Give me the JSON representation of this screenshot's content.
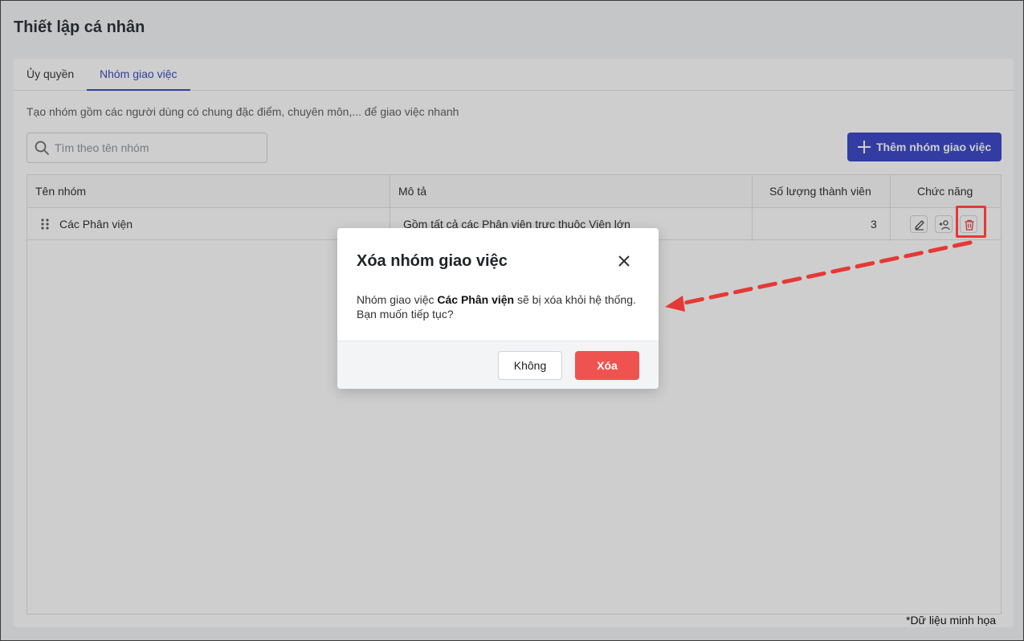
{
  "page": {
    "title": "Thiết lập cá nhân"
  },
  "tabs": [
    {
      "label": "Ủy quyền"
    },
    {
      "label": "Nhóm giao việc",
      "active": true
    }
  ],
  "description": "Tạo nhóm gồm các người dùng có chung đặc điểm, chuyên môn,... để giao việc nhanh",
  "search": {
    "placeholder": "Tìm theo tên nhóm",
    "value": ""
  },
  "add_button": {
    "label": "Thêm nhóm giao việc"
  },
  "table": {
    "headers": [
      "Tên nhóm",
      "Mô tả",
      "Số lượng thành viên",
      "Chức năng"
    ],
    "rows": [
      {
        "name": "Các Phân viện",
        "description": "Gồm tất cả các Phân viện trực thuộc Viện lớn",
        "members": "3"
      }
    ]
  },
  "modal": {
    "title": "Xóa nhóm giao việc",
    "body_prefix": "Nhóm giao việc ",
    "body_group": "Các Phân viện",
    "body_suffix": " sẽ bị xóa khỏi hệ thống.",
    "body_line2": "Bạn muốn tiếp tục?",
    "cancel_label": "Không",
    "confirm_label": "Xóa"
  },
  "note": "*Dữ liệu minh họa",
  "colors": {
    "primary": "#2f3cc4",
    "danger": "#ef5350",
    "annotation": "#e53935"
  },
  "icons": [
    "search-icon",
    "plus-icon",
    "drag-handle-icon",
    "edit-icon",
    "add-member-icon",
    "trash-icon",
    "close-icon"
  ]
}
